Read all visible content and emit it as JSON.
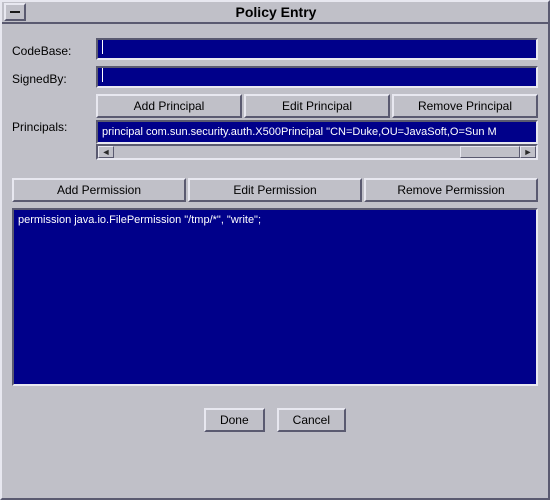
{
  "window": {
    "title": "Policy Entry"
  },
  "labels": {
    "codebase": "CodeBase:",
    "signedby": "SignedBy:",
    "principals": "Principals:"
  },
  "fields": {
    "codebase_value": "",
    "signedby_value": ""
  },
  "principal_buttons": {
    "add": "Add Principal",
    "edit": "Edit Principal",
    "remove": "Remove Principal"
  },
  "principals_list": {
    "items": [
      "principal com.sun.security.auth.X500Principal \"CN=Duke,OU=JavaSoft,O=Sun M"
    ]
  },
  "permission_buttons": {
    "add": "Add Permission",
    "edit": "Edit Permission",
    "remove": "Remove Permission"
  },
  "permissions_list": {
    "items": [
      "permission java.io.FilePermission \"/tmp/*\", \"write\";"
    ]
  },
  "bottom": {
    "done": "Done",
    "cancel": "Cancel"
  }
}
